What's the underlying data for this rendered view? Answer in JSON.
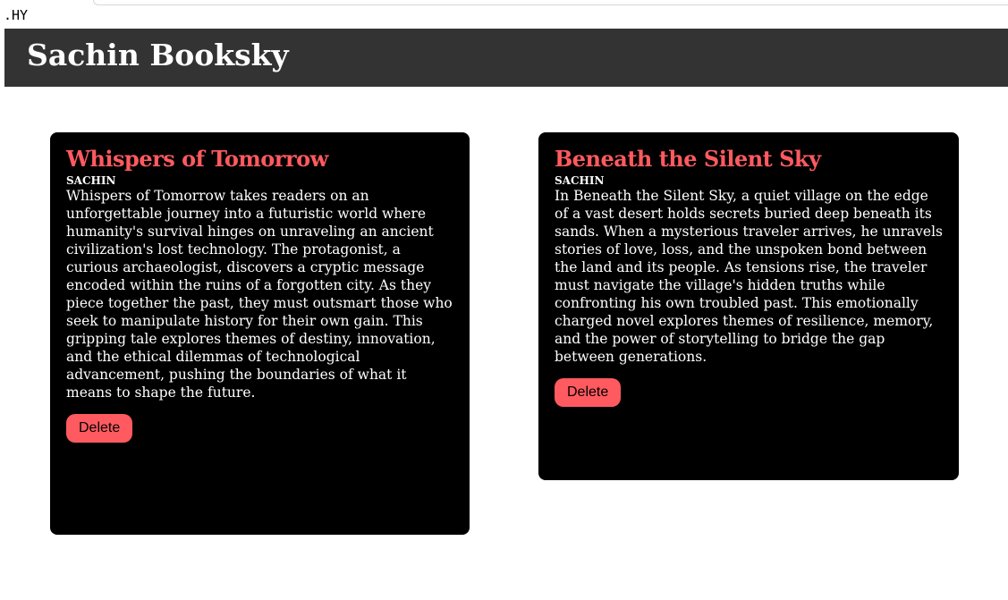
{
  "top": {
    "stray_text": ".HY"
  },
  "header": {
    "title": "Sachin Booksky"
  },
  "books": [
    {
      "title": "Whispers of Tomorrow",
      "author": "SACHIN",
      "description": "Whispers of Tomorrow takes readers on an unforgettable journey into a futuristic world where humanity's survival hinges on unraveling an ancient civilization's lost technology. The protagonist, a curious archaeologist, discovers a cryptic message encoded within the ruins of a forgotten city. As they piece together the past, they must outsmart those who seek to manipulate history for their own gain. This gripping tale explores themes of destiny, innovation, and the ethical dilemmas of technological advancement, pushing the boundaries of what it means to shape the future.",
      "delete_label": "Delete"
    },
    {
      "title": "Beneath the Silent Sky",
      "author": "SACHIN",
      "description": "In Beneath the Silent Sky, a quiet village on the edge of a vast desert holds secrets buried deep beneath its sands. When a mysterious traveler arrives, he unravels stories of love, loss, and the unspoken bond between the land and its people. As tensions rise, the traveler must navigate the village's hidden truths while confronting his own troubled past. This emotionally charged novel explores themes of resilience, memory, and the power of storytelling to bridge the gap between generations.",
      "delete_label": "Delete"
    }
  ],
  "colors": {
    "header_bg": "#333333",
    "card_bg": "#000000",
    "accent": "#ff5a5f",
    "text": "#ffffff"
  }
}
